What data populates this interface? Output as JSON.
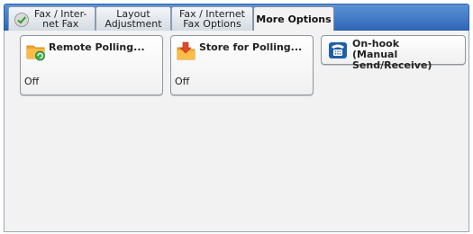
{
  "tabs": [
    {
      "label": "Fax / Inter-\nnet Fax",
      "icon": "fax-checkmark-icon",
      "active": false
    },
    {
      "label": "Layout\nAdjustment",
      "active": false
    },
    {
      "label": "Fax / Internet\nFax Options",
      "active": false
    },
    {
      "label": "More Options",
      "active": true
    }
  ],
  "buttons": {
    "remote_polling": {
      "title": "Remote Polling...",
      "value": "Off",
      "icon": "folder-polling-icon"
    },
    "store_for_polling": {
      "title": "Store for Polling...",
      "value": "Off",
      "icon": "folder-store-icon"
    },
    "on_hook": {
      "title": "On-hook\n(Manual Send/Receive)",
      "icon": "telephone-icon"
    }
  },
  "colors": {
    "tabbar": "#2f67b8",
    "background": "#f2f2f2",
    "folder": "#f5a623",
    "accent_green": "#3fae49",
    "accent_red": "#e04a2a",
    "phone_blue": "#1e5fa8"
  }
}
